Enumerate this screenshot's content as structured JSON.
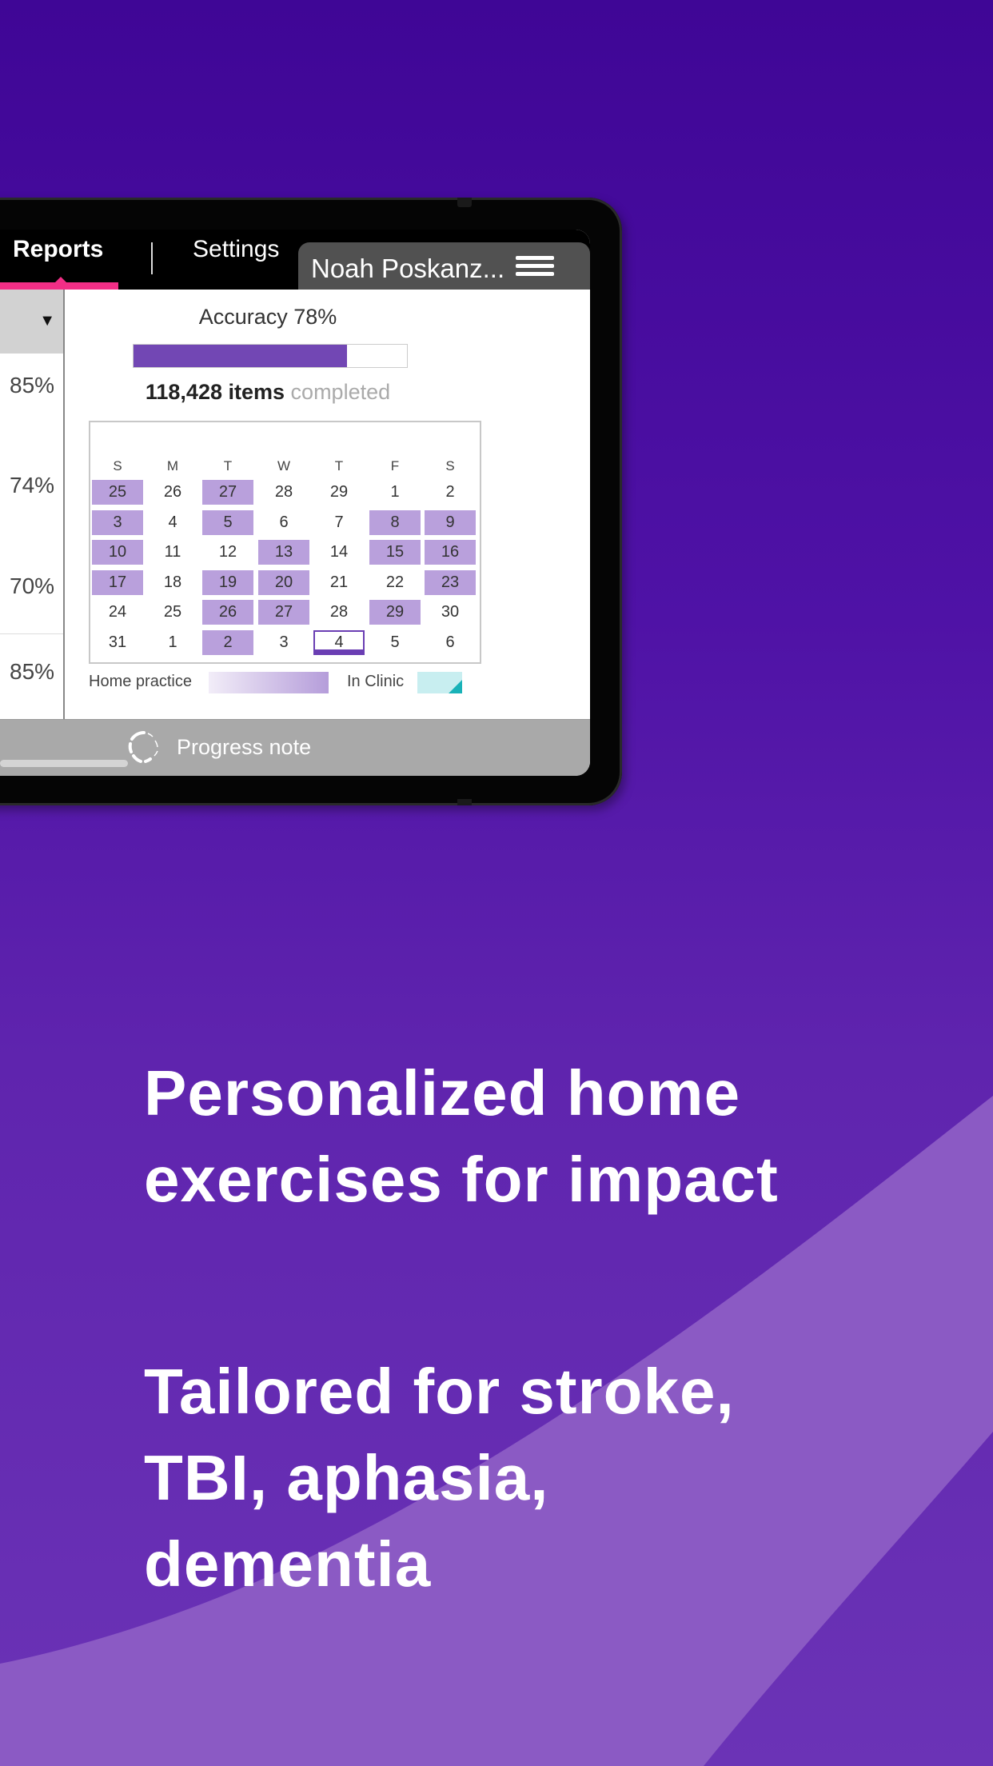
{
  "theme": {
    "accent_pink": "#f22e86",
    "accent_purple": "#7247b4",
    "calendar_highlight": "#b9a0dc",
    "clinic_color": "#19b2b8"
  },
  "nav": {
    "tabs": [
      {
        "label": "Reports",
        "active": true
      },
      {
        "label": "Settings",
        "active": false
      }
    ],
    "user_name": "Noah Poskanz...",
    "menu_icon": "hamburger-menu-icon"
  },
  "left_column": {
    "dropdown_icon": "triangle-down-icon",
    "percentages": [
      "85%",
      "74%",
      "70%",
      "85%"
    ]
  },
  "summary": {
    "accuracy_label": "Accuracy 78%",
    "accuracy_value": 78,
    "items_count": "118,428 items",
    "items_suffix": "completed"
  },
  "calendar": {
    "weekdays": [
      "S",
      "M",
      "T",
      "W",
      "T",
      "F",
      "S"
    ],
    "weeks": [
      [
        {
          "d": "25",
          "on": true
        },
        {
          "d": "26",
          "on": false
        },
        {
          "d": "27",
          "on": true
        },
        {
          "d": "28",
          "on": false
        },
        {
          "d": "29",
          "on": false
        },
        {
          "d": "1",
          "on": false
        },
        {
          "d": "2",
          "on": false
        }
      ],
      [
        {
          "d": "3",
          "on": true
        },
        {
          "d": "4",
          "on": false
        },
        {
          "d": "5",
          "on": true
        },
        {
          "d": "6",
          "on": false
        },
        {
          "d": "7",
          "on": false
        },
        {
          "d": "8",
          "on": true
        },
        {
          "d": "9",
          "on": true
        }
      ],
      [
        {
          "d": "10",
          "on": true
        },
        {
          "d": "11",
          "on": false
        },
        {
          "d": "12",
          "on": false
        },
        {
          "d": "13",
          "on": true
        },
        {
          "d": "14",
          "on": false
        },
        {
          "d": "15",
          "on": true
        },
        {
          "d": "16",
          "on": true
        }
      ],
      [
        {
          "d": "17",
          "on": true
        },
        {
          "d": "18",
          "on": false
        },
        {
          "d": "19",
          "on": true
        },
        {
          "d": "20",
          "on": true
        },
        {
          "d": "21",
          "on": false
        },
        {
          "d": "22",
          "on": false
        },
        {
          "d": "23",
          "on": true
        }
      ],
      [
        {
          "d": "24",
          "on": false
        },
        {
          "d": "25",
          "on": false
        },
        {
          "d": "26",
          "on": true
        },
        {
          "d": "27",
          "on": true
        },
        {
          "d": "28",
          "on": false
        },
        {
          "d": "29",
          "on": true
        },
        {
          "d": "30",
          "on": false
        }
      ],
      [
        {
          "d": "31",
          "on": false
        },
        {
          "d": "1",
          "on": false
        },
        {
          "d": "2",
          "on": true
        },
        {
          "d": "3",
          "on": false
        },
        {
          "d": "4",
          "on": false,
          "today": true
        },
        {
          "d": "5",
          "on": false
        },
        {
          "d": "6",
          "on": false
        }
      ]
    ],
    "legend": {
      "home_label": "Home practice",
      "clinic_label": "In Clinic"
    }
  },
  "footer": {
    "progress_note_label": "Progress note",
    "icon": "loading-spinner-icon"
  },
  "headlines": {
    "primary": [
      "Personalized home",
      "exercises for impact"
    ],
    "secondary": [
      "Tailored for stroke,",
      "TBI, aphasia,",
      "dementia"
    ]
  }
}
